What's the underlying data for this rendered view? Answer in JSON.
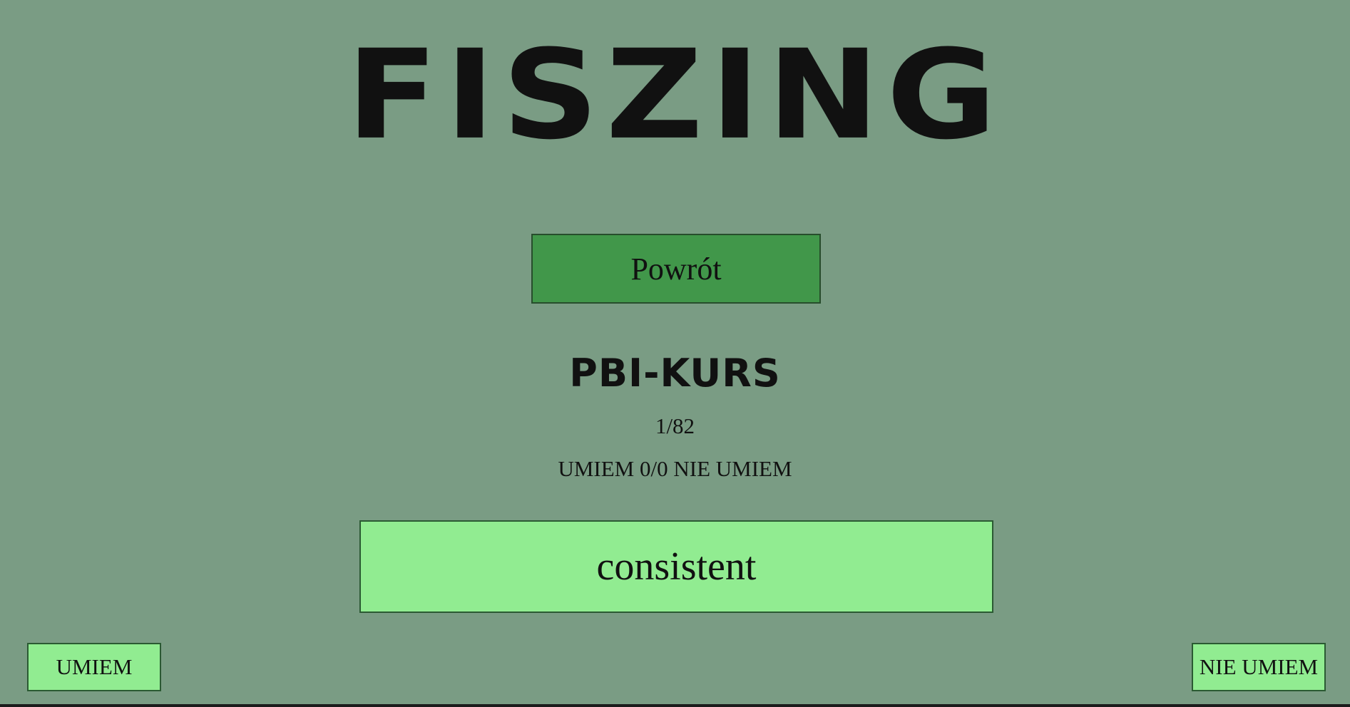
{
  "app": {
    "logo_text": "FISZING"
  },
  "nav": {
    "back_label": "Powrót"
  },
  "course": {
    "title": "PBI-KURS",
    "progress": "1/82",
    "score_line": "UMIEM 0/0 NIE UMIEM"
  },
  "card": {
    "word": "consistent"
  },
  "actions": {
    "known_label": "UMIEM",
    "unknown_label": "NIE UMIEM"
  },
  "colors": {
    "background": "#7a9c84",
    "back_button": "#41974a",
    "card": "#91ec91",
    "text": "#111111"
  }
}
